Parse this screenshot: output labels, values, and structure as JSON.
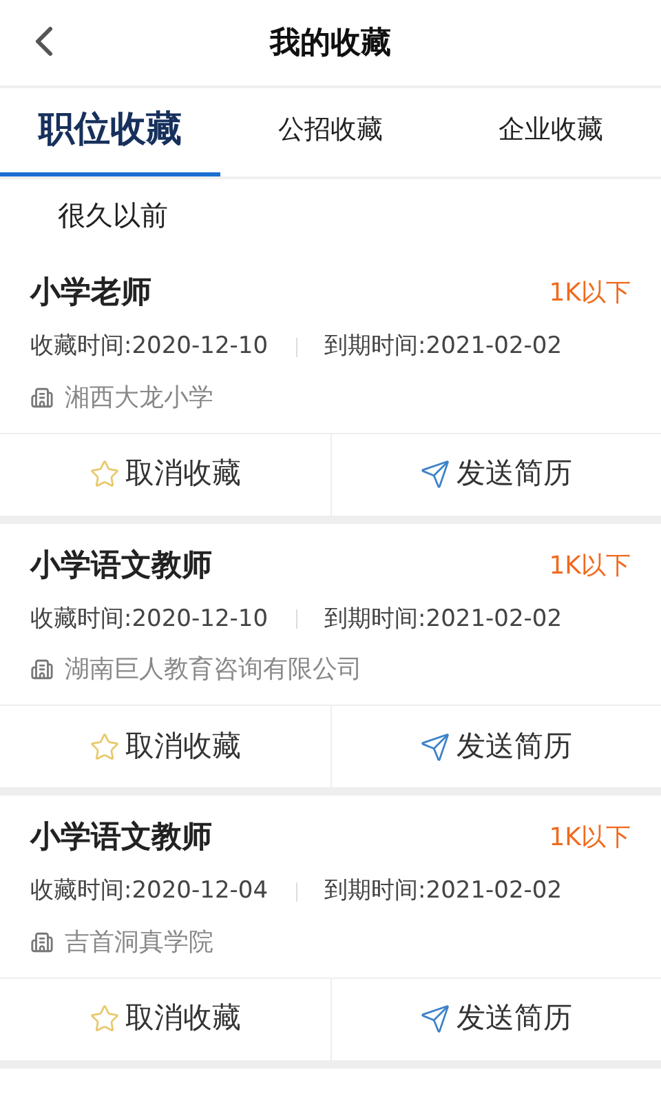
{
  "header": {
    "title": "我的收藏"
  },
  "tabs": [
    {
      "label": "职位收藏",
      "selected": true
    },
    {
      "label": "公招收藏",
      "selected": false
    },
    {
      "label": "企业收藏",
      "selected": false
    }
  ],
  "section_label": "很久以前",
  "jobs": [
    {
      "title": "小学老师",
      "salary": "1K以下",
      "saved_time": "收藏时间:2020-12-10",
      "expire_time": "到期时间:2021-02-02",
      "company": "湘西大龙小学",
      "actions": [
        "取消收藏",
        "发送简历"
      ]
    },
    {
      "title": "小学语文教师",
      "salary": "1K以下",
      "saved_time": "收藏时间:2020-12-10",
      "expire_time": "到期时间:2021-02-02",
      "company": "湖南巨人教育咨询有限公司",
      "actions": [
        "取消收藏",
        "发送简历"
      ]
    },
    {
      "title": "小学语文教师",
      "salary": "1K以下",
      "saved_time": "收藏时间:2020-12-04",
      "expire_time": "到期时间:2021-02-02",
      "company": "吉首洞真学院",
      "actions": [
        "取消收藏",
        "发送简历"
      ]
    }
  ]
}
